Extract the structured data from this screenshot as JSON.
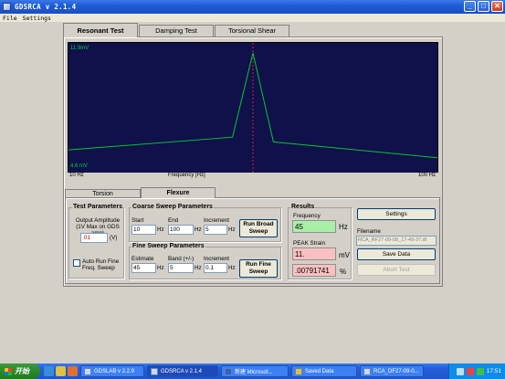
{
  "window": {
    "title": "GDSRCA v 2.1.4"
  },
  "menu": {
    "file": "File",
    "settings": "Settings"
  },
  "tabs": [
    {
      "label": "Resonant Test",
      "active": true
    },
    {
      "label": "Damping Test",
      "active": false
    },
    {
      "label": "Torsional Shear",
      "active": false
    }
  ],
  "graph": {
    "y_top_label": "11.9mV",
    "y_bottom_label": "4.6 mV",
    "x_left_label": "10 Hz",
    "x_center_label": "Frequency [Hz]",
    "x_right_label": "100 Hz",
    "background": "#10104a",
    "line_color": "#00c830",
    "marker_color": "#d02040",
    "trace": [
      {
        "hz": 10,
        "mv": 5.8
      },
      {
        "hz": 50,
        "mv": 6.6
      },
      {
        "hz": 55,
        "mv": 11.9
      },
      {
        "hz": 60,
        "mv": 6.3
      },
      {
        "hz": 100,
        "mv": 5.3
      }
    ],
    "marker_hz": 55
  },
  "subtabs": [
    {
      "label": "Torsion",
      "active": false
    },
    {
      "label": "Flexure",
      "active": true
    }
  ],
  "test_params": {
    "title": "Test Parameters",
    "amp_label": "Output Amplitude (1V Max on GDS amp)",
    "amp_value": ".01",
    "amp_unit": "(V)",
    "auto_label": "Auto Run Fine Freq. Sweep"
  },
  "coarse": {
    "title": "Coarse Sweep Parameters",
    "start_label": "Start",
    "start_value": "10",
    "start_unit": "Hz",
    "end_label": "End",
    "end_value": "100",
    "end_unit": "Hz",
    "inc_label": "Increment",
    "inc_value": "5",
    "inc_unit": "Hz",
    "run_label": "Run Broad Sweep"
  },
  "fine": {
    "title": "Fine Sweep Parameters",
    "est_label": "Estimate",
    "est_value": "45",
    "est_unit": "Hz",
    "band_label": "Band (+/-)",
    "band_value": "5",
    "band_unit": "Hz",
    "inc_label": "Increment",
    "inc_value": "0.1",
    "inc_unit": "Hz",
    "run_label": "Run Fine Sweep"
  },
  "results": {
    "title": "Results",
    "freq_label": "Frequency",
    "freq_value": "45",
    "freq_unit": "Hz",
    "strain_label": "PEAK Strain",
    "strain_value": "11.",
    "strain_unit": "mV",
    "pct_value": ".00791741",
    "pct_unit": "%"
  },
  "right_panel": {
    "settings_label": "Settings",
    "filename_label": "Filename",
    "filename_value": "RCA_RF27-09-08_17-49-37.dt",
    "save_label": "Save Data",
    "abort_label": "Abort Test"
  },
  "taskbar": {
    "start_label": "开始",
    "tasks": [
      {
        "label": "GDSLAB v 2.2.9"
      },
      {
        "label": "GDSRCA v 2.1.4"
      },
      {
        "label": "新建 Microsof..."
      },
      {
        "label": "Saved Data"
      },
      {
        "label": "RCA_DF27-09-0..."
      }
    ],
    "clock": "17:51"
  }
}
